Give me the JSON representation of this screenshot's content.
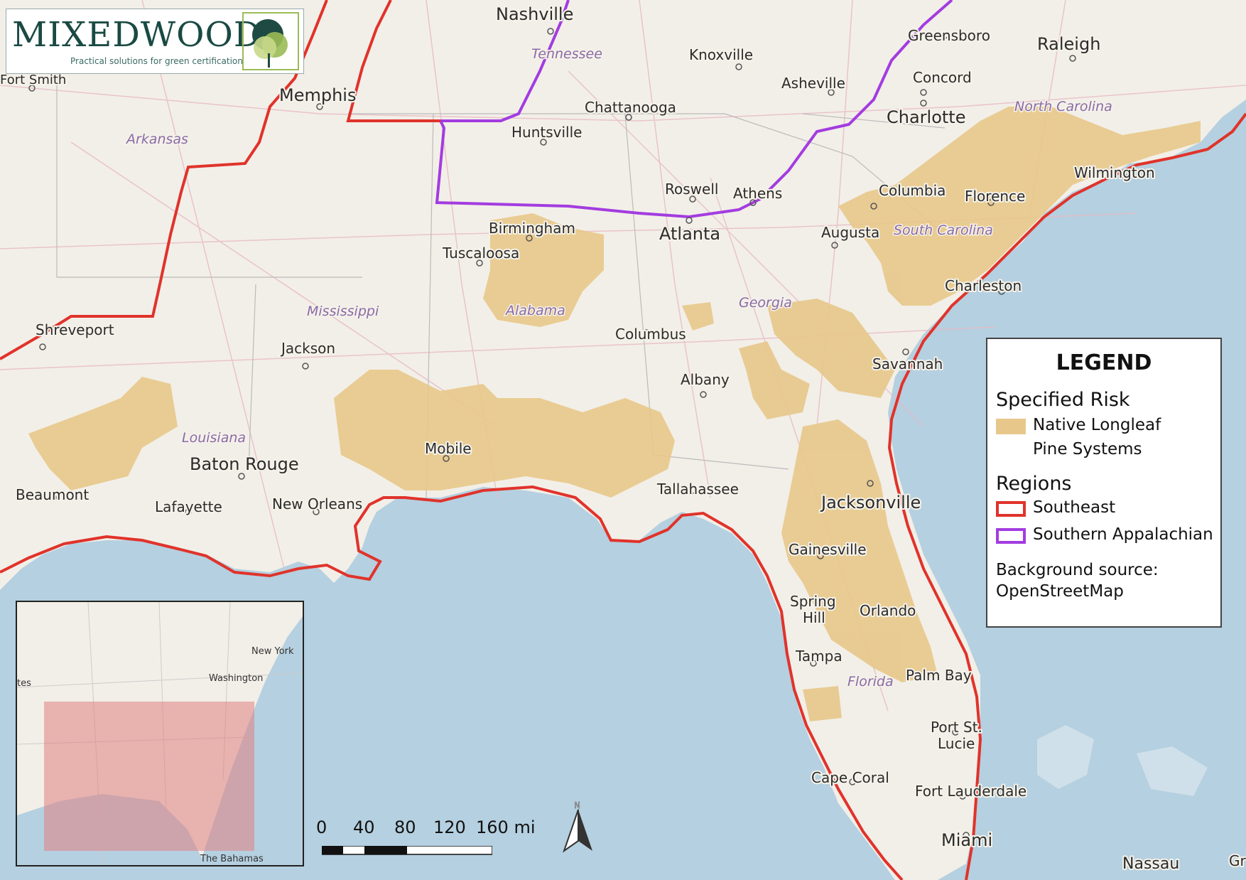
{
  "logo": {
    "name": "MIXEDWOOD",
    "tagline": "Practical solutions for green certification"
  },
  "cities": [
    {
      "name": "Nashville",
      "size": 24
    },
    {
      "name": "Knoxville",
      "size": 20
    },
    {
      "name": "Greensboro",
      "size": 20
    },
    {
      "name": "Raleigh",
      "size": 24
    },
    {
      "name": "Fort Smith",
      "size": 18
    },
    {
      "name": "Memphis",
      "size": 24
    },
    {
      "name": "Asheville",
      "size": 20
    },
    {
      "name": "Concord",
      "size": 20
    },
    {
      "name": "Chattanooga",
      "size": 20
    },
    {
      "name": "Huntsville",
      "size": 20
    },
    {
      "name": "Charlotte",
      "size": 24
    },
    {
      "name": "Wilmington",
      "size": 20
    },
    {
      "name": "Roswell",
      "size": 20
    },
    {
      "name": "Athens",
      "size": 20
    },
    {
      "name": "Columbia",
      "size": 20
    },
    {
      "name": "Florence",
      "size": 20
    },
    {
      "name": "Birmingham",
      "size": 20
    },
    {
      "name": "Atlanta",
      "size": 24
    },
    {
      "name": "Augusta",
      "size": 20
    },
    {
      "name": "Tuscaloosa",
      "size": 20
    },
    {
      "name": "Charleston",
      "size": 20
    },
    {
      "name": "Shreveport",
      "size": 20
    },
    {
      "name": "Jackson",
      "size": 20
    },
    {
      "name": "Columbus",
      "size": 20
    },
    {
      "name": "Savannah",
      "size": 20
    },
    {
      "name": "Albany",
      "size": 20
    },
    {
      "name": "Mobile",
      "size": 20
    },
    {
      "name": "Baton Rouge",
      "size": 24
    },
    {
      "name": "Beaumont",
      "size": 20
    },
    {
      "name": "Lafayette",
      "size": 20
    },
    {
      "name": "New Orleans",
      "size": 20
    },
    {
      "name": "Tallahassee",
      "size": 20
    },
    {
      "name": "Jacksonville",
      "size": 24
    },
    {
      "name": "Gainesville",
      "size": 20
    },
    {
      "name": "Spring",
      "size": 20
    },
    {
      "name": "Hill",
      "size": 20
    },
    {
      "name": "Orlando",
      "size": 20
    },
    {
      "name": "Tampa",
      "size": 20
    },
    {
      "name": "Palm Bay",
      "size": 20
    },
    {
      "name": "Port St.",
      "size": 20
    },
    {
      "name": "Lucie",
      "size": 20
    },
    {
      "name": "Cape Coral",
      "size": 20
    },
    {
      "name": "Fort Lauderdale",
      "size": 20
    },
    {
      "name": "Miami",
      "size": 24
    },
    {
      "name": "Nassau",
      "size": 22
    },
    {
      "name": "Gr",
      "size": 20
    }
  ],
  "states": [
    "Tennessee",
    "North Carolina",
    "Arkansas",
    "South Carolina",
    "Alabama",
    "Georgia",
    "Mississippi",
    "Louisiana",
    "Florida"
  ],
  "legend": {
    "title": "LEGEND",
    "group1": "Specified Risk",
    "item1_line1": "Native Longleaf",
    "item1_line2": "Pine Systems",
    "group2": "Regions",
    "item2": "Southeast",
    "item3": "Southern Appalachian",
    "source_line1": "Background source:",
    "source_line2": "OpenStreetMap"
  },
  "colors": {
    "longleaf": "#e8c88a",
    "southeast": "#e0332b",
    "appalachian": "#a33ce0",
    "water": "#b5d0e0",
    "land": "#f2efe8"
  },
  "inset": {
    "labels": [
      "New York",
      "Washington",
      "tes",
      "The Bahamas"
    ]
  },
  "scale": {
    "ticks": [
      "0",
      "40",
      "80",
      "120",
      "160 mi"
    ]
  },
  "north": "N"
}
